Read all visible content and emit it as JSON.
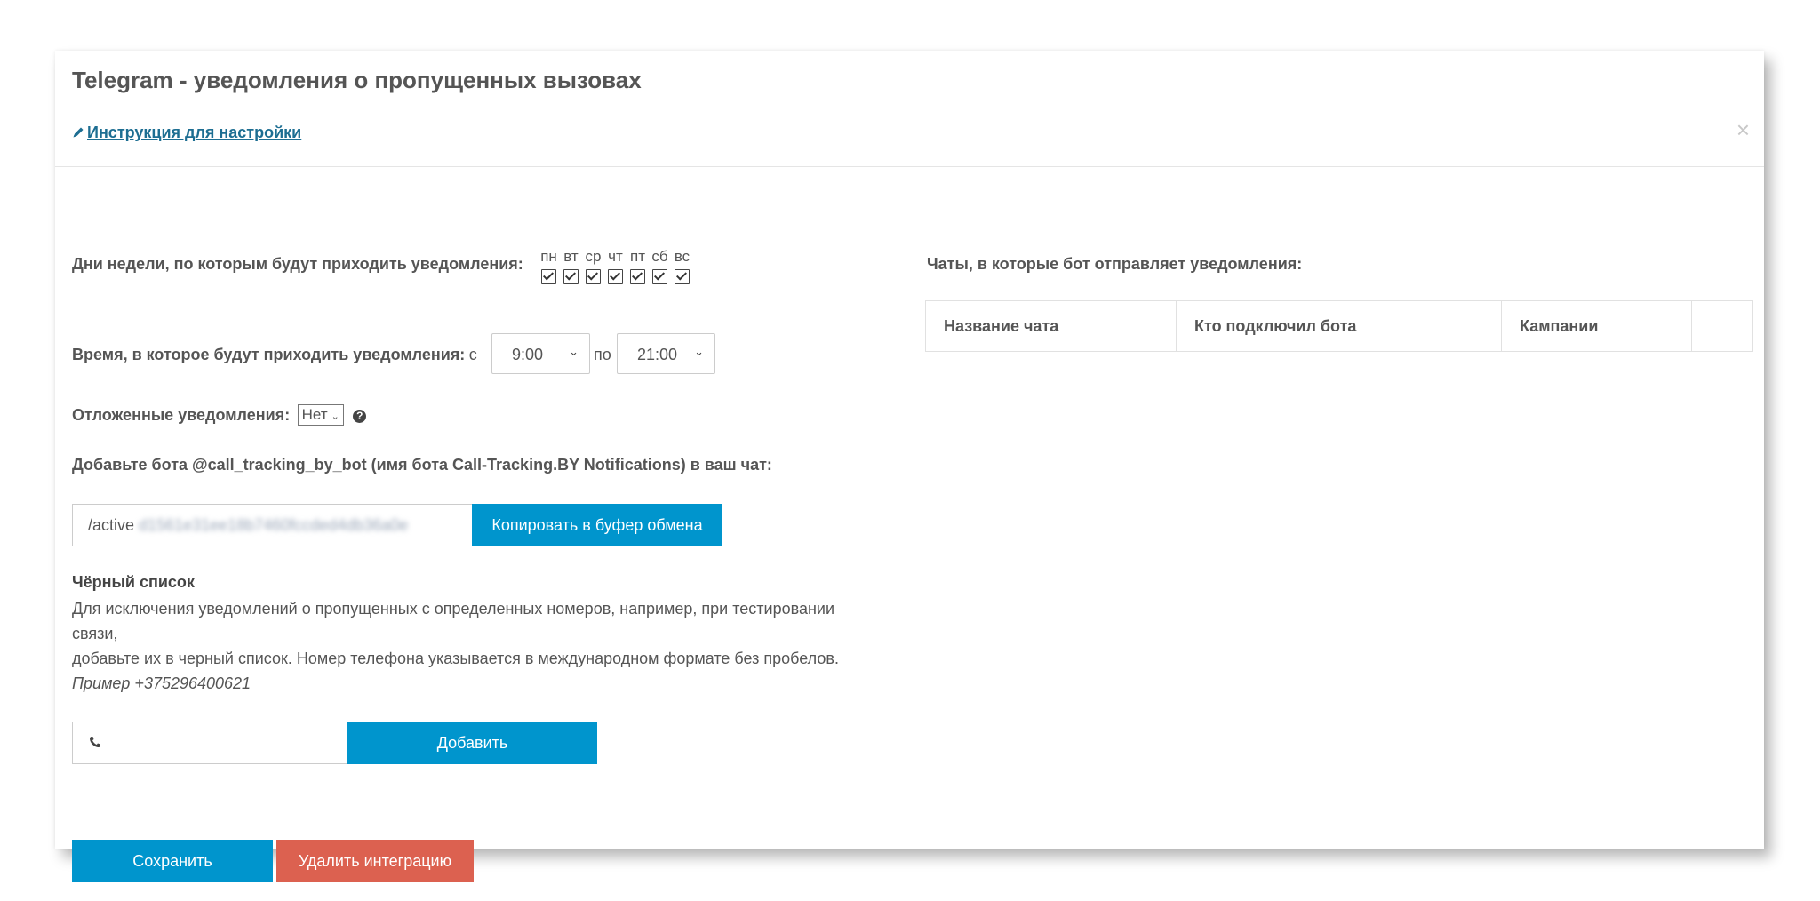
{
  "header": {
    "title": "Telegram - уведомления о пропущенных вызовах",
    "instruction_link": "Инструкция для настройки",
    "close": "×"
  },
  "days": {
    "label": "Дни недели, по которым будут приходить уведомления:",
    "items": [
      {
        "name": "пн",
        "checked": true
      },
      {
        "name": "вт",
        "checked": true
      },
      {
        "name": "ср",
        "checked": true
      },
      {
        "name": "чт",
        "checked": true
      },
      {
        "name": "пт",
        "checked": true
      },
      {
        "name": "сб",
        "checked": true
      },
      {
        "name": "вс",
        "checked": true
      }
    ]
  },
  "time": {
    "label": "Время, в которое будут приходить уведомления:",
    "from_word": "с",
    "from_value": "9:00",
    "to_word": "по",
    "to_value": "21:00"
  },
  "delayed": {
    "label": "Отложенные уведомления:",
    "value": "Нет"
  },
  "bot": {
    "label": "Добавьте бота @call_tracking_by_bot (имя бота Call-Tracking.BY Notifications) в ваш чат:",
    "command_prefix": "/active",
    "command_token": "d1561e31ee18b7460fccded4db36a0e",
    "copy_button": "Копировать в буфер обмена"
  },
  "blacklist": {
    "title": "Чёрный список",
    "line1": "Для исключения уведомлений о пропущенных с определенных номеров, например, при тестировании связи,",
    "line2": "добавьте их в черный список. Номер телефона указывается в международном формате без пробелов.",
    "example": "Пример +375296400621",
    "phone_value": "",
    "add_button": "Добавить"
  },
  "actions": {
    "save": "Сохранить",
    "delete": "Удалить интеграцию"
  },
  "chats": {
    "title": "Чаты, в которые бот отправляет уведомления:",
    "columns": [
      "Название чата",
      "Кто подключил бота",
      "Кампании",
      ""
    ]
  },
  "colors": {
    "primary": "#0095cd",
    "danger": "#dc6150",
    "link": "#1d6e92"
  }
}
